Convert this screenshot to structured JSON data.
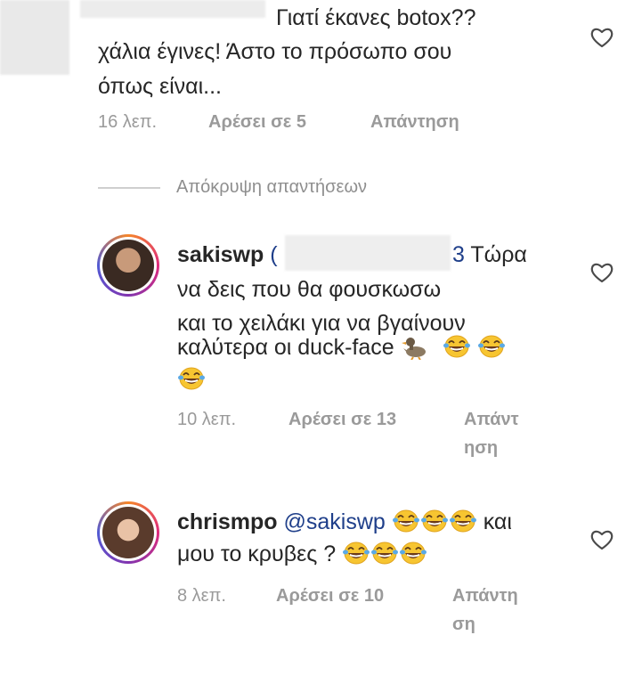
{
  "comment1": {
    "line1": "Γιατί έκανες botox??",
    "line2": "χάλια έγινες! Άστο το πρόσωπο σου",
    "line3": "όπως είναι...",
    "time": "16 λεπ.",
    "likes": "Αρέσει σε 5",
    "reply": "Απάντηση"
  },
  "hide_replies": "Απόκρυψη απαντήσεων",
  "comment2": {
    "username": "sakiswp",
    "mention_open": "(",
    "mention_end": "3",
    "line1_tail": "Τώρα",
    "line2": "να δεις που θα φουσκωσω",
    "line3": "και το χειλάκι για να βγαίνουν",
    "line4": "καλύτερα οι duck-face",
    "time": "10 λεπ.",
    "likes": "Αρέσει σε 13",
    "reply_line1": "Απάντ",
    "reply_line2": "ηση"
  },
  "comment3": {
    "username": "chrismpo",
    "mention": "@sakiswp",
    "line1_tail": "και",
    "line2": "μου το κρυβες ?",
    "time": "8 λεπ.",
    "likes": "Αρέσει σε 10",
    "reply_line1": "Απάντη",
    "reply_line2": "ση"
  },
  "icons": {
    "heart": "heart-outline-icon",
    "duck": "duck-emoji-icon",
    "laugh": "tears-of-joy-emoji-icon"
  }
}
